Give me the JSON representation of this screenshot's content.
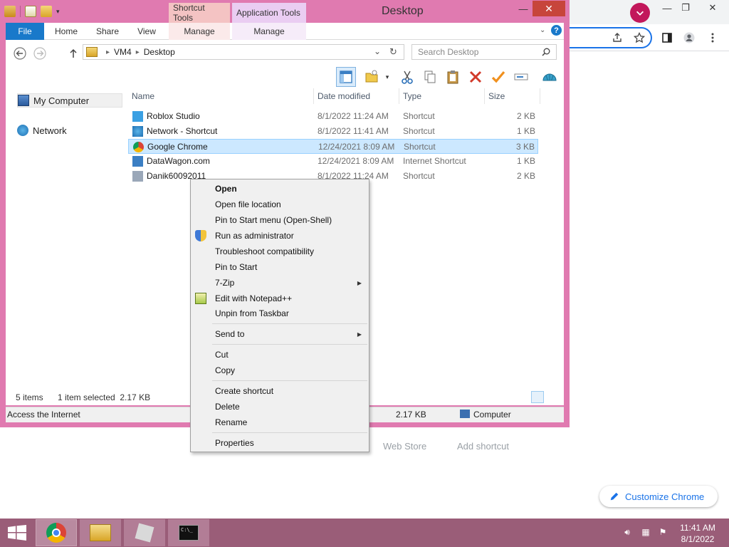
{
  "window": {
    "title": "Desktop",
    "context_tabs": {
      "shortcut_tools": "Shortcut Tools",
      "application_tools": "Application Tools"
    },
    "controls": {
      "minimize": "—",
      "maximize": "□",
      "close": "✕"
    }
  },
  "ribbon": {
    "tabs": [
      "File",
      "Home",
      "Share",
      "View",
      "Manage",
      "Manage"
    ],
    "help": "?"
  },
  "address": {
    "crumbs": [
      "VM4",
      "Desktop"
    ],
    "search_placeholder": "Search Desktop"
  },
  "nav_pane": {
    "items": [
      "My Computer",
      "Network"
    ]
  },
  "file_list": {
    "columns": [
      "Name",
      "Date modified",
      "Type",
      "Size"
    ],
    "rows": [
      {
        "name": "Roblox Studio",
        "date": "8/1/2022 11:24 AM",
        "type": "Shortcut",
        "size": "2 KB"
      },
      {
        "name": "Network - Shortcut",
        "date": "8/1/2022 11:41 AM",
        "type": "Shortcut",
        "size": "1 KB"
      },
      {
        "name": "Google Chrome",
        "date": "12/24/2021 8:09 AM",
        "type": "Shortcut",
        "size": "3 KB"
      },
      {
        "name": "DataWagon.com",
        "date": "12/24/2021 8:09 AM",
        "type": "Internet Shortcut",
        "size": "1 KB"
      },
      {
        "name": "Danik60092011",
        "date": "8/1/2022 11:24 AM",
        "type": "Shortcut",
        "size": "2 KB"
      }
    ],
    "selected_index": 2
  },
  "status": {
    "item_count": "5 items",
    "selection": "1 item selected  2.17 KB",
    "info_text": "Access the Internet",
    "info_size": "2.17 KB",
    "info_location": "Computer"
  },
  "context_menu": {
    "items": [
      "Open",
      "Open file location",
      "Pin to Start menu (Open-Shell)",
      "Run as administrator",
      "Troubleshoot compatibility",
      "Pin to Start",
      "7-Zip",
      "Edit with Notepad++",
      "Unpin from Taskbar",
      "Send to",
      "Cut",
      "Copy",
      "Create shortcut",
      "Delete",
      "Rename",
      "Properties"
    ]
  },
  "chrome": {
    "shortcuts": [
      "Web Store",
      "Add shortcut"
    ],
    "customize": "Customize Chrome"
  },
  "taskbar": {
    "time": "11:41 AM",
    "date": "8/1/2022"
  },
  "colors": {
    "window_frame": "#e07ab0",
    "accent_blue": "#1979ca",
    "taskbar": "#9a5d78",
    "selection": "#cce8ff"
  }
}
